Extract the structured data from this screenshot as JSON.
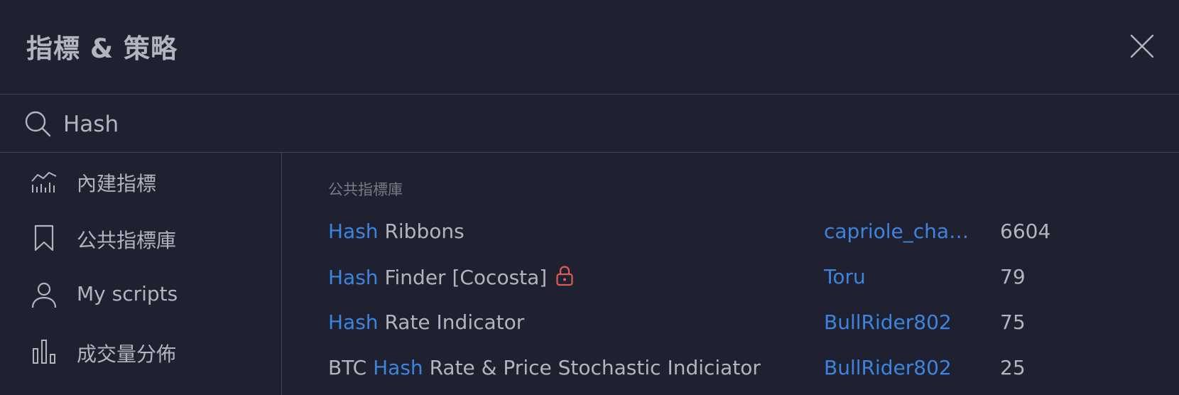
{
  "dialog": {
    "title": "指標 & 策略"
  },
  "search": {
    "value": "Hash",
    "placeholder": ""
  },
  "sidebar": {
    "items": [
      {
        "label": "內建指標",
        "icon": "chart-line-icon"
      },
      {
        "label": "公共指標庫",
        "icon": "bookmark-icon"
      },
      {
        "label": "My scripts",
        "icon": "user-icon"
      },
      {
        "label": "成交量分佈",
        "icon": "volume-profile-icon"
      }
    ]
  },
  "results": {
    "section_title": "公共指標庫",
    "rows": [
      {
        "prefix": "",
        "highlight": "Hash",
        "suffix": " Ribbons",
        "author": "capriole_charl...",
        "count": "6604",
        "locked": false
      },
      {
        "prefix": "",
        "highlight": "Hash",
        "suffix": " Finder [Cocosta]",
        "author": "Toru",
        "count": "79",
        "locked": true
      },
      {
        "prefix": "",
        "highlight": "Hash",
        "suffix": " Rate Indicator",
        "author": "BullRider802",
        "count": "75",
        "locked": false
      },
      {
        "prefix": "BTC ",
        "highlight": "Hash",
        "suffix": " Rate & Price Stochastic Indiciator",
        "author": "BullRider802",
        "count": "25",
        "locked": false
      }
    ]
  },
  "colors": {
    "background": "#1f2130",
    "divider": "#434651",
    "text": "#b2b5be",
    "muted": "#787b86",
    "highlight": "#3d84de",
    "lock": "#e05a5a"
  }
}
